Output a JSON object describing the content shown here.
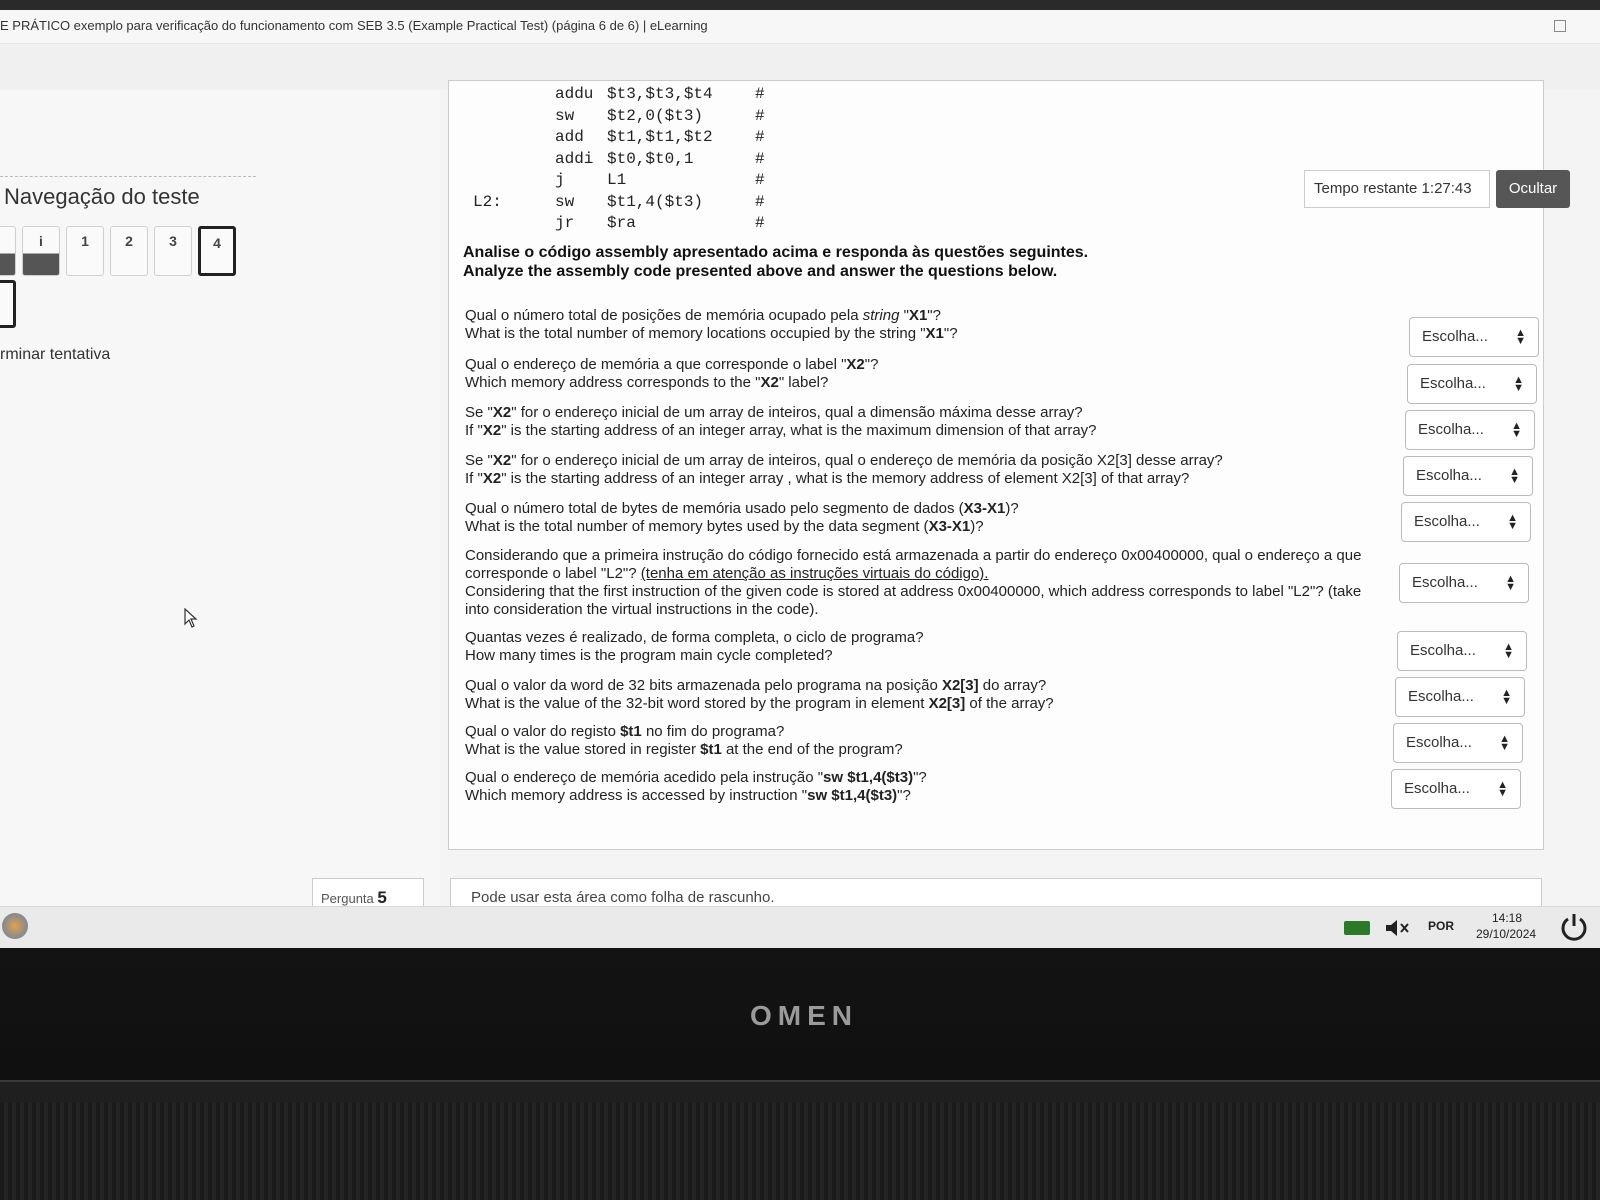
{
  "window": {
    "title": "E PRÁTICO exemplo para verificação do funcionamento com SEB 3.5 (Example Practical Test) (página 6 de 6) | eLearning"
  },
  "sidebar": {
    "nav_title": "Navegação do teste",
    "nav_buttons": [
      "i",
      "1",
      "2",
      "3",
      "4"
    ],
    "finish_link": "rminar tentativa"
  },
  "code": [
    {
      "label": "",
      "op": "addu",
      "args": "$t3,$t3,$t4",
      "comment": "#"
    },
    {
      "label": "",
      "op": "sw",
      "args": "$t2,0($t3)",
      "comment": "#"
    },
    {
      "label": "",
      "op": "add",
      "args": "$t1,$t1,$t2",
      "comment": "#"
    },
    {
      "label": "",
      "op": "addi",
      "args": "$t0,$t0,1",
      "comment": "#"
    },
    {
      "label": "",
      "op": "j",
      "args": "L1",
      "comment": "#"
    },
    {
      "label": "L2:",
      "op": "sw",
      "args": "$t1,4($t3)",
      "comment": "#"
    },
    {
      "label": "",
      "op": "jr",
      "args": "$ra",
      "comment": "#"
    }
  ],
  "instructions": {
    "pt": "Analise o código assembly apresentado acima e responda às questões seguintes.",
    "en": "Analyze the assembly code presented above and answer the questions below."
  },
  "select_placeholder": "Escolha...",
  "timer": {
    "label": "Tempo restante 1:27:43",
    "hide_button": "Ocultar"
  },
  "questions": [
    {
      "pt_pre": "Qual o número total de posições de memória ocupado pela ",
      "pt_em": "string",
      "pt_mid": " \"",
      "pt_b": "X1",
      "pt_post": "\"?",
      "en_pre": "What is the total number of memory locations occupied by the string \"",
      "en_b": "X1",
      "en_post": "\"?"
    },
    {
      "pt_pre": "Qual o endereço de memória a que corresponde o label \"",
      "pt_em": "",
      "pt_mid": "",
      "pt_b": "X2",
      "pt_post": "\"?",
      "en_pre": "Which memory address corresponds to the \"",
      "en_b": "X2",
      "en_post": "\" label?"
    },
    {
      "pt_pre": "Se \"",
      "pt_em": "",
      "pt_mid": "",
      "pt_b": "X2",
      "pt_post": "\" for o endereço inicial de um array de inteiros, qual a dimensão máxima desse array?",
      "en_pre": "If \"",
      "en_b": "X2",
      "en_post": "\" is the starting address of an integer array, what is the maximum dimension of that array?"
    },
    {
      "pt_pre": "Se \"",
      "pt_em": "",
      "pt_mid": "",
      "pt_b": "X2",
      "pt_post": "\" for o endereço inicial de um array de inteiros, qual o endereço de memória da posição X2[3] desse array?",
      "en_pre": "If \"",
      "en_b": "X2",
      "en_post": "\" is the starting address of an integer array , what is the memory address of element X2[3] of that array?"
    },
    {
      "pt_pre": "Qual o número total de bytes de memória usado pelo segmento de dados (",
      "pt_em": "",
      "pt_mid": "",
      "pt_b": "X3-X1",
      "pt_post": ")?",
      "en_pre": "What is the total number of memory bytes used by the data segment (",
      "en_b": "X3-X1",
      "en_post": ")?"
    },
    {
      "pt_pre": "Considerando que a primeira instrução do código fornecido está armazenada a partir do endereço 0x00400000, qual o endereço a que corresponde o label \"L2\"? ",
      "pt_em": "",
      "pt_mid": "",
      "pt_b": "",
      "pt_post": "(tenha em atenção as instruções virtuais do código).",
      "en_pre": "Considering that the first instruction of the given code is stored at address 0x00400000, which address corresponds to label \"L2\"? (take into consideration the virtual instructions in the code).",
      "en_b": "",
      "en_post": ""
    },
    {
      "pt_pre": "Quantas vezes é realizado, de forma completa, o ciclo de programa?",
      "pt_em": "",
      "pt_mid": "",
      "pt_b": "",
      "pt_post": "",
      "en_pre": "How many times is the program main cycle completed?",
      "en_b": "",
      "en_post": ""
    },
    {
      "pt_pre": "Qual o valor da word de 32 bits armazenada pelo programa na posição ",
      "pt_em": "",
      "pt_mid": "",
      "pt_b": "X2[3]",
      "pt_post": " do array?",
      "en_pre": "What is the value of the 32-bit word stored by the program in element ",
      "en_b": "X2[3]",
      "en_post": " of the array?"
    },
    {
      "pt_pre": "Qual o valor do registo ",
      "pt_em": "",
      "pt_mid": "",
      "pt_b": "$t1",
      "pt_post": " no fim do programa?",
      "en_pre": "What is the value stored in register ",
      "en_b": "$t1",
      "en_post": " at the end of the program?"
    },
    {
      "pt_pre": "Qual o endereço de memória acedido pela instrução \"",
      "pt_em": "",
      "pt_mid": "",
      "pt_b": "sw $t1,4($t3)",
      "pt_post": "\"?",
      "en_pre": "Which memory address is accessed by instruction \"",
      "en_b": "sw $t1,4($t3)",
      "en_post": "\"?"
    }
  ],
  "footer": {
    "question_badge_label": "Pergunta",
    "question_badge_number": "5",
    "scratch_text": "Pode usar esta área como folha de rascunho."
  },
  "taskbar": {
    "language": "POR",
    "time": "14:18",
    "date": "29/10/2024"
  },
  "laptop": {
    "logo": "OMEN"
  },
  "colors": {
    "hide_button_bg": "#565656",
    "battery": "#2a7a2a"
  }
}
